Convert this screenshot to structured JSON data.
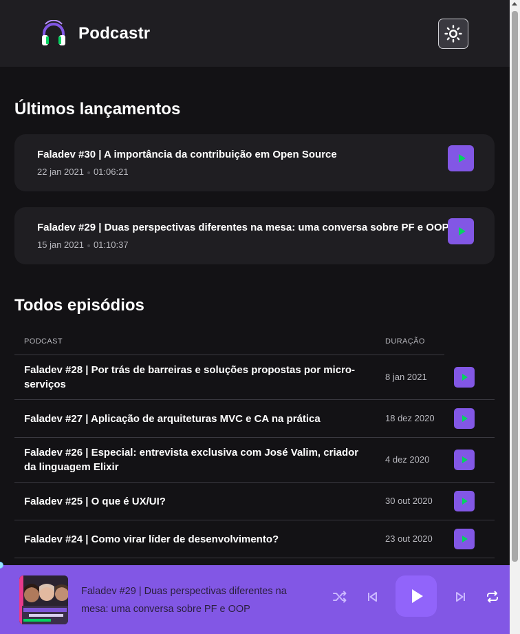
{
  "app": {
    "name": "Podcastr"
  },
  "sections": {
    "latest_title": "Últimos lançamentos",
    "all_title": "Todos episódios"
  },
  "latest": [
    {
      "title": "Faladev #30 | A importância da contribuição em Open Source",
      "date": "22 jan 2021",
      "duration": "01:06:21"
    },
    {
      "title": "Faladev #29 | Duas perspectivas diferentes na mesa: uma conversa sobre PF e OOP",
      "date": "15 jan 2021",
      "duration": "01:10:37"
    }
  ],
  "table": {
    "headers": {
      "podcast": "PODCAST",
      "duration": "DURAÇÃO"
    },
    "rows": [
      {
        "title": "Faladev #28 | Por trás de barreiras e soluções propostas por micro-serviços",
        "date": "8 jan 2021"
      },
      {
        "title": "Faladev #27 | Aplicação de arquiteturas MVC e CA na prática",
        "date": "18 dez 2020"
      },
      {
        "title": "Faladev #26 | Especial: entrevista exclusiva com José Valim, criador da linguagem Elixir",
        "date": "4 dez 2020"
      },
      {
        "title": "Faladev #25 | O que é UX/UI?",
        "date": "30 out 2020"
      },
      {
        "title": "Faladev #24 | Como virar líder de desenvolvimento?",
        "date": "23 out 2020"
      }
    ]
  },
  "player": {
    "now_playing": "Faladev #29 | Duas perspectivas diferentes na mesa: uma conversa sobre PF e OOP",
    "thumbnail_caption": "Programação funcional x devs orientados a objetos",
    "progress": 0
  },
  "icons": {
    "logo": "headphones-icon",
    "theme": "sun-icon",
    "play": "play-icon",
    "shuffle": "shuffle-icon",
    "previous": "skip-previous-icon",
    "next": "skip-next-icon",
    "repeat": "repeat-icon"
  },
  "colors": {
    "accent": "#8257e5",
    "play_triangle": "#04d361",
    "background": "#131215",
    "card": "#1f1e22"
  }
}
